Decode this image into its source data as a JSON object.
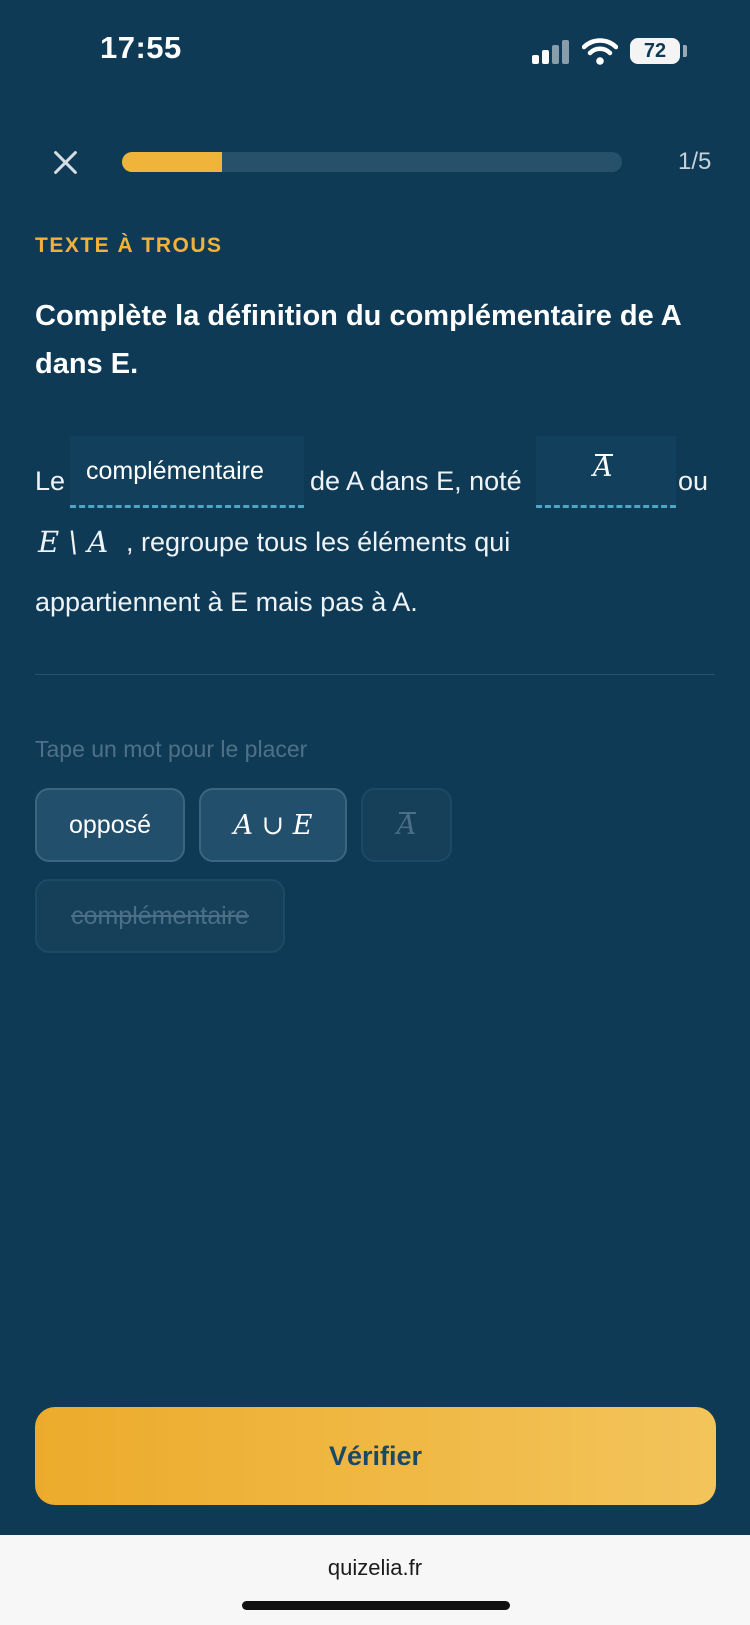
{
  "status_bar": {
    "time": "17:55",
    "battery": "72"
  },
  "header": {
    "progress_count": "1/5",
    "progress_fraction": 0.2
  },
  "exercise": {
    "type_label": "TEXTE À TROUS",
    "question": "Complète la définition du complémentaire de A dans E."
  },
  "sentence": {
    "part1": "Le",
    "blank1": "complémentaire",
    "part2": "de A dans E, noté",
    "blank2_symbol": "A",
    "part3": "ou",
    "math_set_difference": "E \\ A",
    "part4": ", regroupe tous les éléments qui",
    "part5": "appartiennent à E mais pas à A."
  },
  "word_bank": {
    "hint": "Tape un mot pour le placer",
    "chips": [
      {
        "label": "opposé",
        "used": false
      },
      {
        "label": "A ∪ E",
        "used": false
      },
      {
        "label": "A",
        "used": true
      },
      {
        "label": "complémentaire",
        "used": true
      }
    ]
  },
  "actions": {
    "verify_label": "Vérifier"
  },
  "footer": {
    "url": "quizelia.fr"
  },
  "colors": {
    "background": "#0f3a56",
    "accent": "#f2b23a",
    "button": "#f0b43a"
  }
}
